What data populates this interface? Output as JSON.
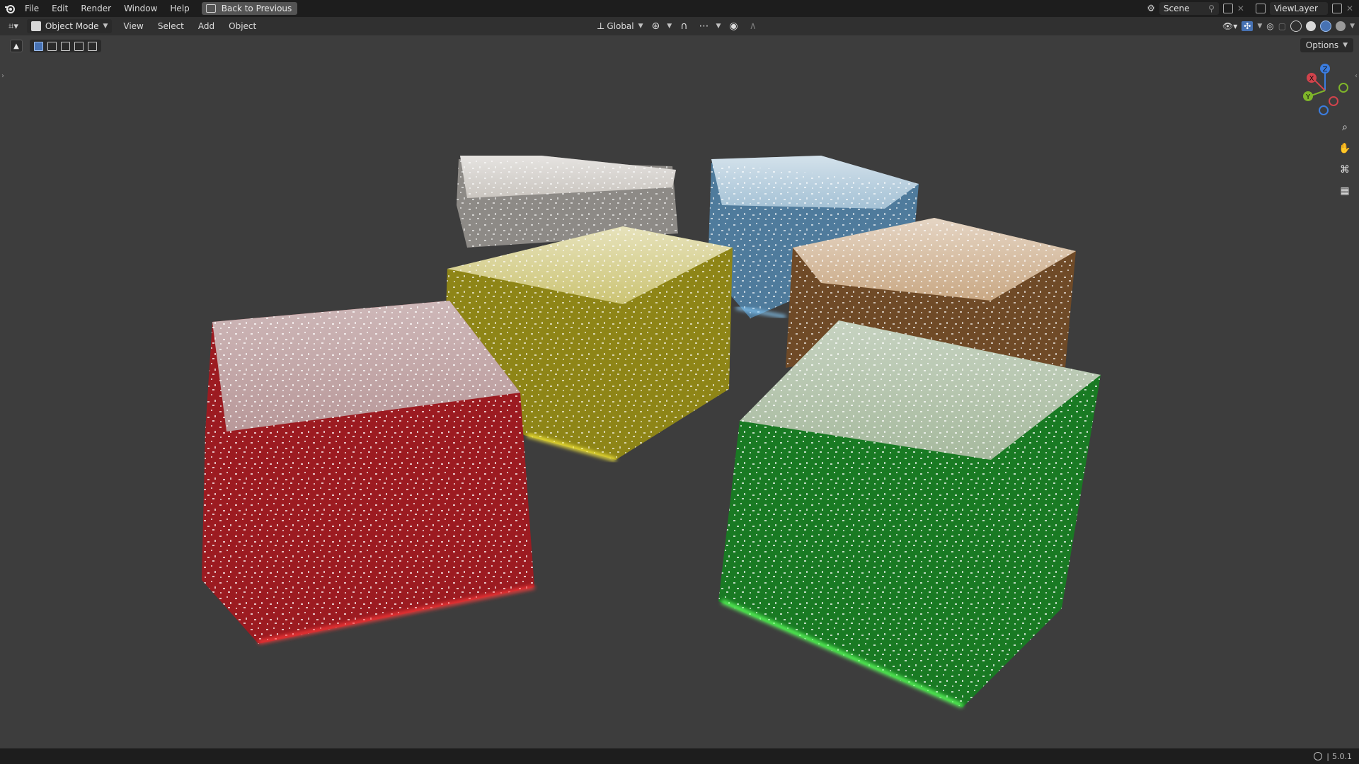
{
  "topbar": {
    "menus": [
      "File",
      "Edit",
      "Render",
      "Window",
      "Help"
    ],
    "back_button": "Back to Previous",
    "scene_label": "Scene",
    "view_layer_label": "ViewLayer"
  },
  "header": {
    "mode": "Object Mode",
    "menus": [
      "View",
      "Select",
      "Add",
      "Object"
    ],
    "transform_orientation": "Global"
  },
  "viewport": {
    "options_label": "Options",
    "gizmo_axes": [
      "X",
      "Y",
      "Z"
    ],
    "objects": [
      {
        "name": "clear-cube",
        "color": "#b7b2ad"
      },
      {
        "name": "blue-cube",
        "color": "#6a96b6"
      },
      {
        "name": "yellow-cube",
        "color": "#b3a825"
      },
      {
        "name": "orange-cube",
        "color": "#9a6a37"
      },
      {
        "name": "red-cube",
        "color": "#b0232a"
      },
      {
        "name": "green-cube",
        "color": "#1f8f2a"
      }
    ]
  },
  "statusbar": {
    "version": "5.0.1"
  },
  "colors": {
    "accent": "#4772b3",
    "background": "#3d3d3d"
  }
}
